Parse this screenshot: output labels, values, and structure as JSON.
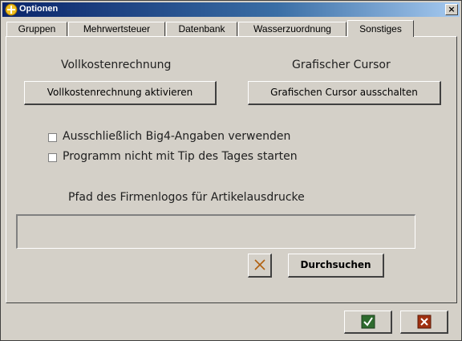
{
  "window": {
    "title": "Optionen",
    "close_glyph": "×"
  },
  "tabs": [
    {
      "label": "Gruppen"
    },
    {
      "label": "Mehrwertsteuer"
    },
    {
      "label": "Datenbank"
    },
    {
      "label": "Wasserzuordnung"
    },
    {
      "label": "Sonstiges"
    }
  ],
  "active_tab": "Sonstiges",
  "sonstiges": {
    "vollkosten": {
      "heading": "Vollkostenrechnung",
      "button": "Vollkostenrechnung aktivieren"
    },
    "cursor": {
      "heading": "Grafischer Cursor",
      "button": "Grafischen Cursor ausschalten"
    },
    "checkboxes": [
      {
        "label": "Ausschließlich Big4-Angaben verwenden",
        "checked": false
      },
      {
        "label": "Programm nicht mit Tip des Tages starten",
        "checked": false
      }
    ],
    "logo": {
      "label": "Pfad des Firmenlogos für Artikelausdrucke",
      "path_value": "",
      "browse_button": "Durchsuchen"
    }
  },
  "footer": {
    "ok_icon": "check-icon",
    "cancel_icon": "cancel-icon"
  },
  "colors": {
    "face": "#d4d0c8",
    "title_start": "#0a246a",
    "ok_green": "#2e7d2e",
    "cancel_red": "#c0392b"
  }
}
